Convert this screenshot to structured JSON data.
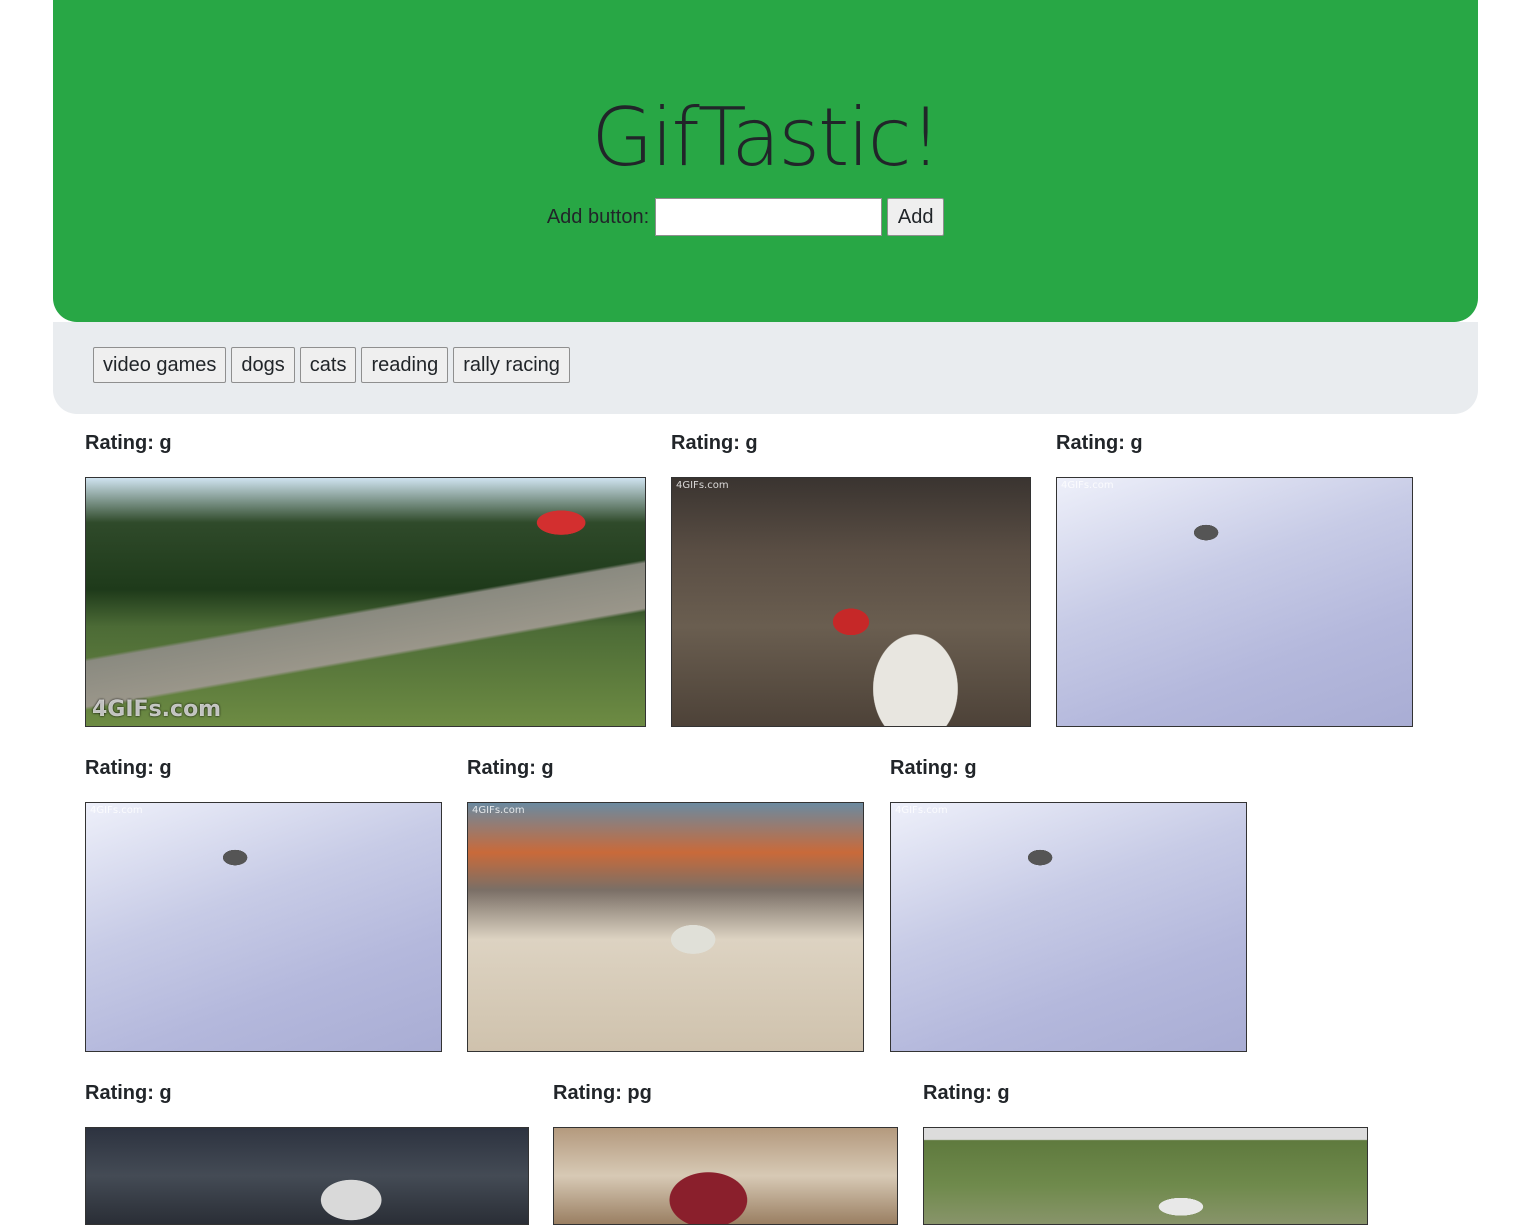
{
  "header": {
    "title": "GifTastic!",
    "add_label": "Add button:",
    "add_input_value": "",
    "add_button_label": "Add"
  },
  "topics": [
    "video games",
    "dogs",
    "cats",
    "reading",
    "rally racing"
  ],
  "gifs": [
    {
      "rating": "Rating: g",
      "scene": "forest",
      "watermark": "4GIFs.com"
    },
    {
      "rating": "Rating: g",
      "scene": "crowd",
      "watermark": "4GIFs.com"
    },
    {
      "rating": "Rating: g",
      "scene": "snow",
      "watermark": "4GIFs.com"
    },
    {
      "rating": "Rating: g",
      "scene": "snow",
      "watermark": "4GIFs.com"
    },
    {
      "rating": "Rating: g",
      "scene": "gravel",
      "watermark": "4GIFs.com"
    },
    {
      "rating": "Rating: g",
      "scene": "snow",
      "watermark": "4GIFs.com"
    },
    {
      "rating": "Rating: g",
      "scene": "dark",
      "watermark": ""
    },
    {
      "rating": "Rating: pg",
      "scene": "dust",
      "watermark": ""
    },
    {
      "rating": "Rating: g",
      "scene": "field",
      "watermark": ""
    }
  ]
}
